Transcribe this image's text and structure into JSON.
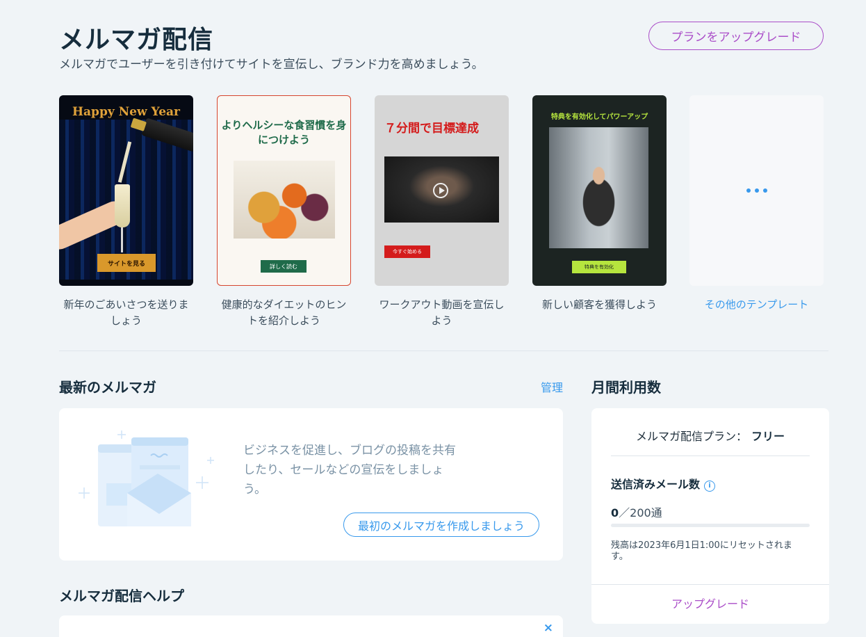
{
  "header": {
    "title": "メルマガ配信",
    "subtitle": "メルマガでユーザーを引き付けてサイトを宣伝し、ブランド力を高めましょう。",
    "upgrade_label": "プランをアップグレード"
  },
  "templates": [
    {
      "caption": "新年のごあいさつを送りましょう",
      "headline": "Happy New Year",
      "button": "サイトを見る",
      "accent": "#d9982b"
    },
    {
      "caption": "健康的なダイエットのヒントを紹介しよう",
      "headline": "よりヘルシーな食習慣を身につけよう",
      "button": "詳しく読む",
      "accent": "#1f6b4a"
    },
    {
      "caption": "ワークアウト動画を宣伝しよう",
      "headline": "７分間で目標達成",
      "button": "今すぐ始める",
      "accent": "#d41c1c"
    },
    {
      "caption": "新しい顧客を獲得しよう",
      "headline": "特典を有効化してパワーアップ",
      "button": "特典を有効化",
      "accent": "#b6e53e"
    },
    {
      "caption": "その他のテンプレート",
      "icon": "more-dots-icon"
    }
  ],
  "latest": {
    "title": "最新のメルマガ",
    "manage_label": "管理",
    "empty_text": "ビジネスを促進し、ブログの投稿を共有したり、セールなどの宣伝をしましょう。",
    "create_label": "最初のメルマガを作成しましょう"
  },
  "help": {
    "title": "メルマガ配信ヘルプ",
    "close_icon": "×"
  },
  "usage": {
    "title": "月間利用数",
    "plan_label": "メルマガ配信プラン：",
    "plan_value": "フリー",
    "sent_label": "送信済みメール数",
    "sent_count": "0",
    "sent_limit": "／200通",
    "progress": 0,
    "reset_text": "残高は2023年6月1日1:00にリセットされます。",
    "upgrade_label": "アップグレード"
  },
  "colors": {
    "accent_blue": "#3899ec",
    "upgrade_purple": "#aa4dc8",
    "background": "#f0f4f7"
  }
}
